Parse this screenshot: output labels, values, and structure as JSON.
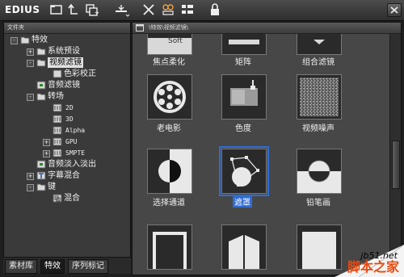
{
  "app": {
    "title": "EDIUS",
    "colors": {
      "titlebar": "#3a3a3a",
      "selection": "#2f6cd3",
      "panel": "#4a4a4a"
    }
  },
  "toolbar": {
    "icons": [
      "new-folder-icon",
      "up-folder-icon",
      "copy-icon",
      "add-to-timeline-icon",
      "delete-icon",
      "properties-icon",
      "view-mode-icon",
      "lock-icon"
    ]
  },
  "left_panel": {
    "header": "文件夹",
    "tree": [
      {
        "label": "特效",
        "expand": "-"
      },
      {
        "label": "系统预设",
        "expand": "+"
      },
      {
        "label": "视频滤镜",
        "expand": "-",
        "selected": true
      },
      {
        "label": "色彩校正",
        "expand": ""
      },
      {
        "label": "音频滤镜",
        "expand": ""
      },
      {
        "label": "转场",
        "expand": "-"
      },
      {
        "label": "2D",
        "expand": ""
      },
      {
        "label": "3D",
        "expand": ""
      },
      {
        "label": "Alpha",
        "expand": ""
      },
      {
        "label": "GPU",
        "expand": "+"
      },
      {
        "label": "SMPTE",
        "expand": "+"
      },
      {
        "label": "音频淡入淡出",
        "expand": ""
      },
      {
        "label": "字幕混合",
        "expand": "+"
      },
      {
        "label": "键",
        "expand": "-"
      },
      {
        "label": "混合",
        "expand": ""
      }
    ]
  },
  "bottom_tabs": [
    "素材库",
    "特效",
    "序列标记"
  ],
  "right_panel": {
    "path": "\\特效\\视频滤镜\\",
    "items": [
      {
        "label": "焦点柔化",
        "overlay": "Soft"
      },
      {
        "label": "矩阵"
      },
      {
        "label": "组合滤镜"
      },
      {
        "label": "老电影"
      },
      {
        "label": "色度"
      },
      {
        "label": "视频噪声"
      },
      {
        "label": "选择通道"
      },
      {
        "label": "遮罩",
        "selected": true
      },
      {
        "label": "铅笔画"
      }
    ]
  },
  "watermark": {
    "site": "jb51.net",
    "name": "脚本之家"
  }
}
